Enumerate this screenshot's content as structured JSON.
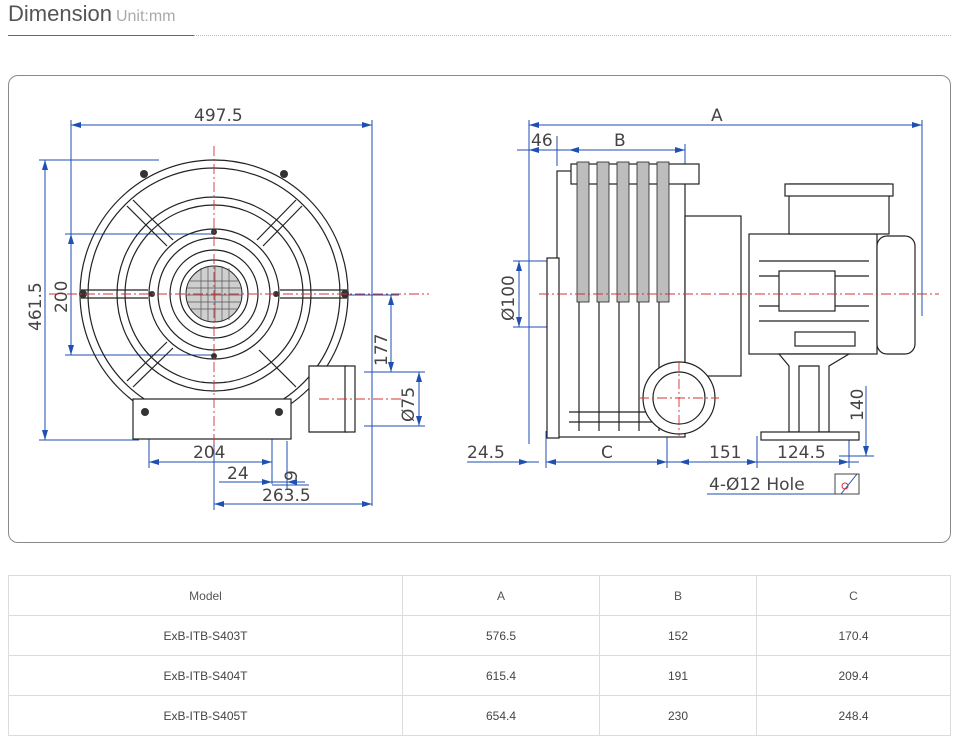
{
  "header": {
    "title": "Dimension",
    "unit": "Unit:mm"
  },
  "drawing": {
    "dims": {
      "width_total": "497.5",
      "height_total": "461.5",
      "inlet_dia_ref": "200",
      "axis_height": "177",
      "outlet_dia": "Ø75",
      "base_span": "204",
      "base_offset": "24",
      "base_nine": "9",
      "base_total": "263.5",
      "side_a": "A",
      "side_46": "46",
      "side_b": "B",
      "side_dia": "Ø100",
      "side_24_5": "24.5",
      "side_c": "C",
      "side_151": "151",
      "side_124_5": "124.5",
      "side_140": "140",
      "hole_note": "4-Ø12 Hole"
    }
  },
  "table": {
    "headers": [
      "Model",
      "A",
      "B",
      "C"
    ],
    "rows": [
      [
        "ExB-ITB-S403T",
        "576.5",
        "152",
        "170.4"
      ],
      [
        "ExB-ITB-S404T",
        "615.4",
        "191",
        "209.4"
      ],
      [
        "ExB-ITB-S405T",
        "654.4",
        "230",
        "248.4"
      ]
    ]
  },
  "colors": {
    "dimension_line": "#1f4fb0",
    "center_line": "#d43030",
    "table_border": "#dcdcdc"
  }
}
